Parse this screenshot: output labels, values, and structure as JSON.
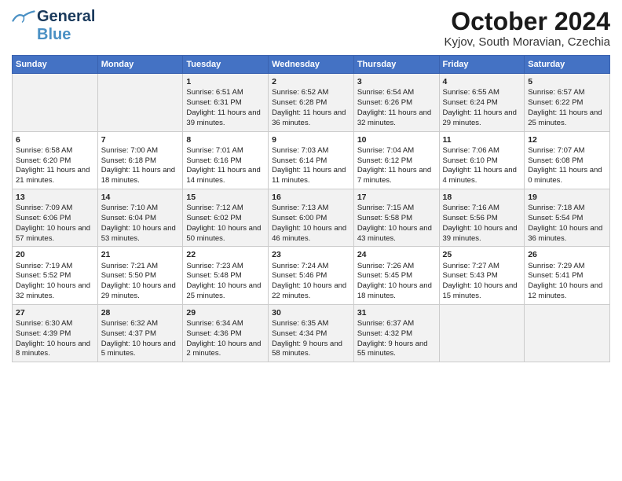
{
  "logo": {
    "line1": "General",
    "line2": "Blue"
  },
  "title": "October 2024",
  "subtitle": "Kyjov, South Moravian, Czechia",
  "days_of_week": [
    "Sunday",
    "Monday",
    "Tuesday",
    "Wednesday",
    "Thursday",
    "Friday",
    "Saturday"
  ],
  "weeks": [
    [
      {
        "day": "",
        "content": ""
      },
      {
        "day": "",
        "content": ""
      },
      {
        "day": "1",
        "content": "Sunrise: 6:51 AM\nSunset: 6:31 PM\nDaylight: 11 hours and 39 minutes."
      },
      {
        "day": "2",
        "content": "Sunrise: 6:52 AM\nSunset: 6:28 PM\nDaylight: 11 hours and 36 minutes."
      },
      {
        "day": "3",
        "content": "Sunrise: 6:54 AM\nSunset: 6:26 PM\nDaylight: 11 hours and 32 minutes."
      },
      {
        "day": "4",
        "content": "Sunrise: 6:55 AM\nSunset: 6:24 PM\nDaylight: 11 hours and 29 minutes."
      },
      {
        "day": "5",
        "content": "Sunrise: 6:57 AM\nSunset: 6:22 PM\nDaylight: 11 hours and 25 minutes."
      }
    ],
    [
      {
        "day": "6",
        "content": "Sunrise: 6:58 AM\nSunset: 6:20 PM\nDaylight: 11 hours and 21 minutes."
      },
      {
        "day": "7",
        "content": "Sunrise: 7:00 AM\nSunset: 6:18 PM\nDaylight: 11 hours and 18 minutes."
      },
      {
        "day": "8",
        "content": "Sunrise: 7:01 AM\nSunset: 6:16 PM\nDaylight: 11 hours and 14 minutes."
      },
      {
        "day": "9",
        "content": "Sunrise: 7:03 AM\nSunset: 6:14 PM\nDaylight: 11 hours and 11 minutes."
      },
      {
        "day": "10",
        "content": "Sunrise: 7:04 AM\nSunset: 6:12 PM\nDaylight: 11 hours and 7 minutes."
      },
      {
        "day": "11",
        "content": "Sunrise: 7:06 AM\nSunset: 6:10 PM\nDaylight: 11 hours and 4 minutes."
      },
      {
        "day": "12",
        "content": "Sunrise: 7:07 AM\nSunset: 6:08 PM\nDaylight: 11 hours and 0 minutes."
      }
    ],
    [
      {
        "day": "13",
        "content": "Sunrise: 7:09 AM\nSunset: 6:06 PM\nDaylight: 10 hours and 57 minutes."
      },
      {
        "day": "14",
        "content": "Sunrise: 7:10 AM\nSunset: 6:04 PM\nDaylight: 10 hours and 53 minutes."
      },
      {
        "day": "15",
        "content": "Sunrise: 7:12 AM\nSunset: 6:02 PM\nDaylight: 10 hours and 50 minutes."
      },
      {
        "day": "16",
        "content": "Sunrise: 7:13 AM\nSunset: 6:00 PM\nDaylight: 10 hours and 46 minutes."
      },
      {
        "day": "17",
        "content": "Sunrise: 7:15 AM\nSunset: 5:58 PM\nDaylight: 10 hours and 43 minutes."
      },
      {
        "day": "18",
        "content": "Sunrise: 7:16 AM\nSunset: 5:56 PM\nDaylight: 10 hours and 39 minutes."
      },
      {
        "day": "19",
        "content": "Sunrise: 7:18 AM\nSunset: 5:54 PM\nDaylight: 10 hours and 36 minutes."
      }
    ],
    [
      {
        "day": "20",
        "content": "Sunrise: 7:19 AM\nSunset: 5:52 PM\nDaylight: 10 hours and 32 minutes."
      },
      {
        "day": "21",
        "content": "Sunrise: 7:21 AM\nSunset: 5:50 PM\nDaylight: 10 hours and 29 minutes."
      },
      {
        "day": "22",
        "content": "Sunrise: 7:23 AM\nSunset: 5:48 PM\nDaylight: 10 hours and 25 minutes."
      },
      {
        "day": "23",
        "content": "Sunrise: 7:24 AM\nSunset: 5:46 PM\nDaylight: 10 hours and 22 minutes."
      },
      {
        "day": "24",
        "content": "Sunrise: 7:26 AM\nSunset: 5:45 PM\nDaylight: 10 hours and 18 minutes."
      },
      {
        "day": "25",
        "content": "Sunrise: 7:27 AM\nSunset: 5:43 PM\nDaylight: 10 hours and 15 minutes."
      },
      {
        "day": "26",
        "content": "Sunrise: 7:29 AM\nSunset: 5:41 PM\nDaylight: 10 hours and 12 minutes."
      }
    ],
    [
      {
        "day": "27",
        "content": "Sunrise: 6:30 AM\nSunset: 4:39 PM\nDaylight: 10 hours and 8 minutes."
      },
      {
        "day": "28",
        "content": "Sunrise: 6:32 AM\nSunset: 4:37 PM\nDaylight: 10 hours and 5 minutes."
      },
      {
        "day": "29",
        "content": "Sunrise: 6:34 AM\nSunset: 4:36 PM\nDaylight: 10 hours and 2 minutes."
      },
      {
        "day": "30",
        "content": "Sunrise: 6:35 AM\nSunset: 4:34 PM\nDaylight: 9 hours and 58 minutes."
      },
      {
        "day": "31",
        "content": "Sunrise: 6:37 AM\nSunset: 4:32 PM\nDaylight: 9 hours and 55 minutes."
      },
      {
        "day": "",
        "content": ""
      },
      {
        "day": "",
        "content": ""
      }
    ]
  ]
}
